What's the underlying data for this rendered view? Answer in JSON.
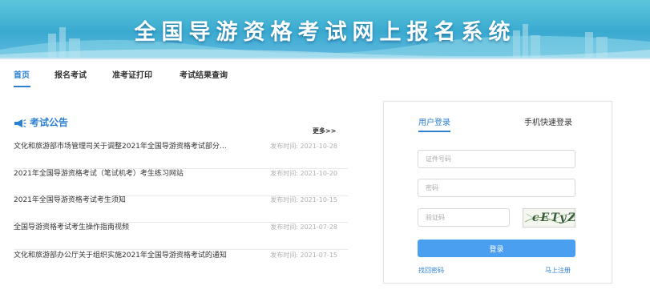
{
  "header": {
    "title": "全国导游资格考试网上报名系统"
  },
  "nav": [
    {
      "label": "首页"
    },
    {
      "label": "报名考试"
    },
    {
      "label": "准考证打印"
    },
    {
      "label": "考试结果查询"
    }
  ],
  "notices": {
    "heading": "考试公告",
    "more": "更多>>",
    "items": [
      {
        "title": "文化和旅游部市场管理司关于调整2021年全国导游资格考试部分…",
        "date": "发布时间: 2021-10-28"
      },
      {
        "title": "2021年全国导游资格考试（笔试机考）考生练习网站",
        "date": "发布时间: 2021-10-20"
      },
      {
        "title": "2021年全国导游资格考试考生须知",
        "date": "发布时间: 2021-10-15"
      },
      {
        "title": "全国导游资格考试考生操作指南视频",
        "date": "发布时间: 2021-07-28"
      },
      {
        "title": "文化和旅游部办公厅关于组织实施2021年全国导游资格考试的通知",
        "date": "发布时间: 2021-07-15"
      }
    ]
  },
  "login": {
    "tab_user": "用户登录",
    "tab_phone": "手机快速登录",
    "id_placeholder": "证件号码",
    "password_placeholder": "密码",
    "captcha_placeholder": "验证码",
    "captcha_text": "cETyZ",
    "button": "登录",
    "forgot": "找回密码",
    "register": "马上注册"
  },
  "colors": {
    "accent": "#2c7fd1",
    "button": "#4a9ff0",
    "banner": "#3aaad0"
  }
}
